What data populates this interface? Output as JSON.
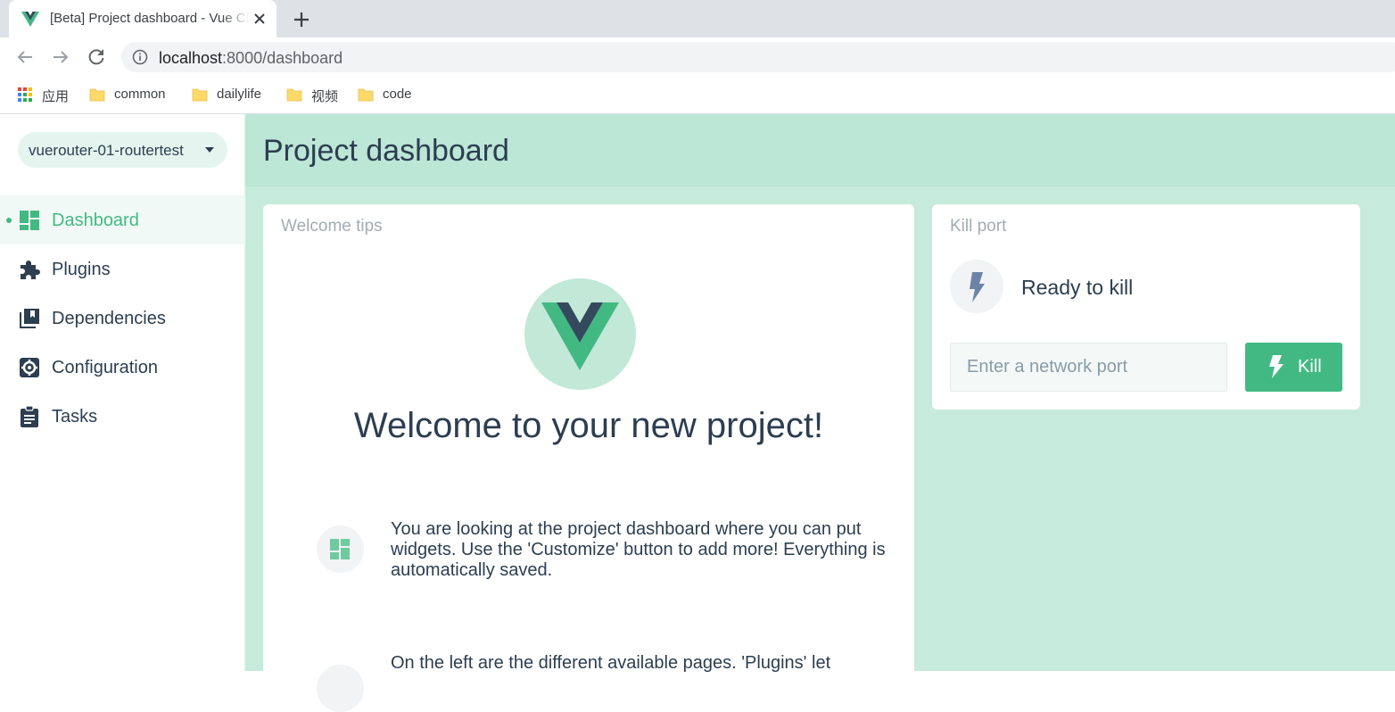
{
  "browser": {
    "tab_title": "[Beta] Project dashboard - Vue CLI",
    "url_host": "localhost",
    "url_rest": ":8000/dashboard",
    "bookmarks": [
      {
        "label": "应用",
        "icon": "apps-grid-icon"
      },
      {
        "label": "common",
        "icon": "folder-icon"
      },
      {
        "label": "dailylife",
        "icon": "folder-icon"
      },
      {
        "label": "视频",
        "icon": "folder-icon"
      },
      {
        "label": "code",
        "icon": "folder-icon"
      }
    ]
  },
  "sidebar": {
    "project_select": "vuerouter-01-routertest",
    "items": [
      {
        "label": "Dashboard",
        "icon": "dashboard-icon",
        "active": true
      },
      {
        "label": "Plugins",
        "icon": "puzzle-icon"
      },
      {
        "label": "Dependencies",
        "icon": "library-books-icon"
      },
      {
        "label": "Configuration",
        "icon": "gear-icon"
      },
      {
        "label": "Tasks",
        "icon": "clipboard-icon"
      }
    ]
  },
  "main": {
    "title": "Project dashboard",
    "welcome": {
      "card_title": "Welcome tips",
      "heading": "Welcome to your new project!",
      "tips": [
        "You are looking at the project dashboard where you can put widgets. Use the 'Customize' button to add more! Everything is automatically saved.",
        "On the left are the different available pages. 'Plugins' let"
      ]
    },
    "kill_port": {
      "card_title": "Kill port",
      "status": "Ready to kill",
      "input_placeholder": "Enter a network port",
      "button_label": "Kill"
    }
  },
  "colors": {
    "accent": "#42b983",
    "header_bg": "#bce6d6",
    "content_bg": "#c6ebdd",
    "text": "#2c3e50"
  }
}
